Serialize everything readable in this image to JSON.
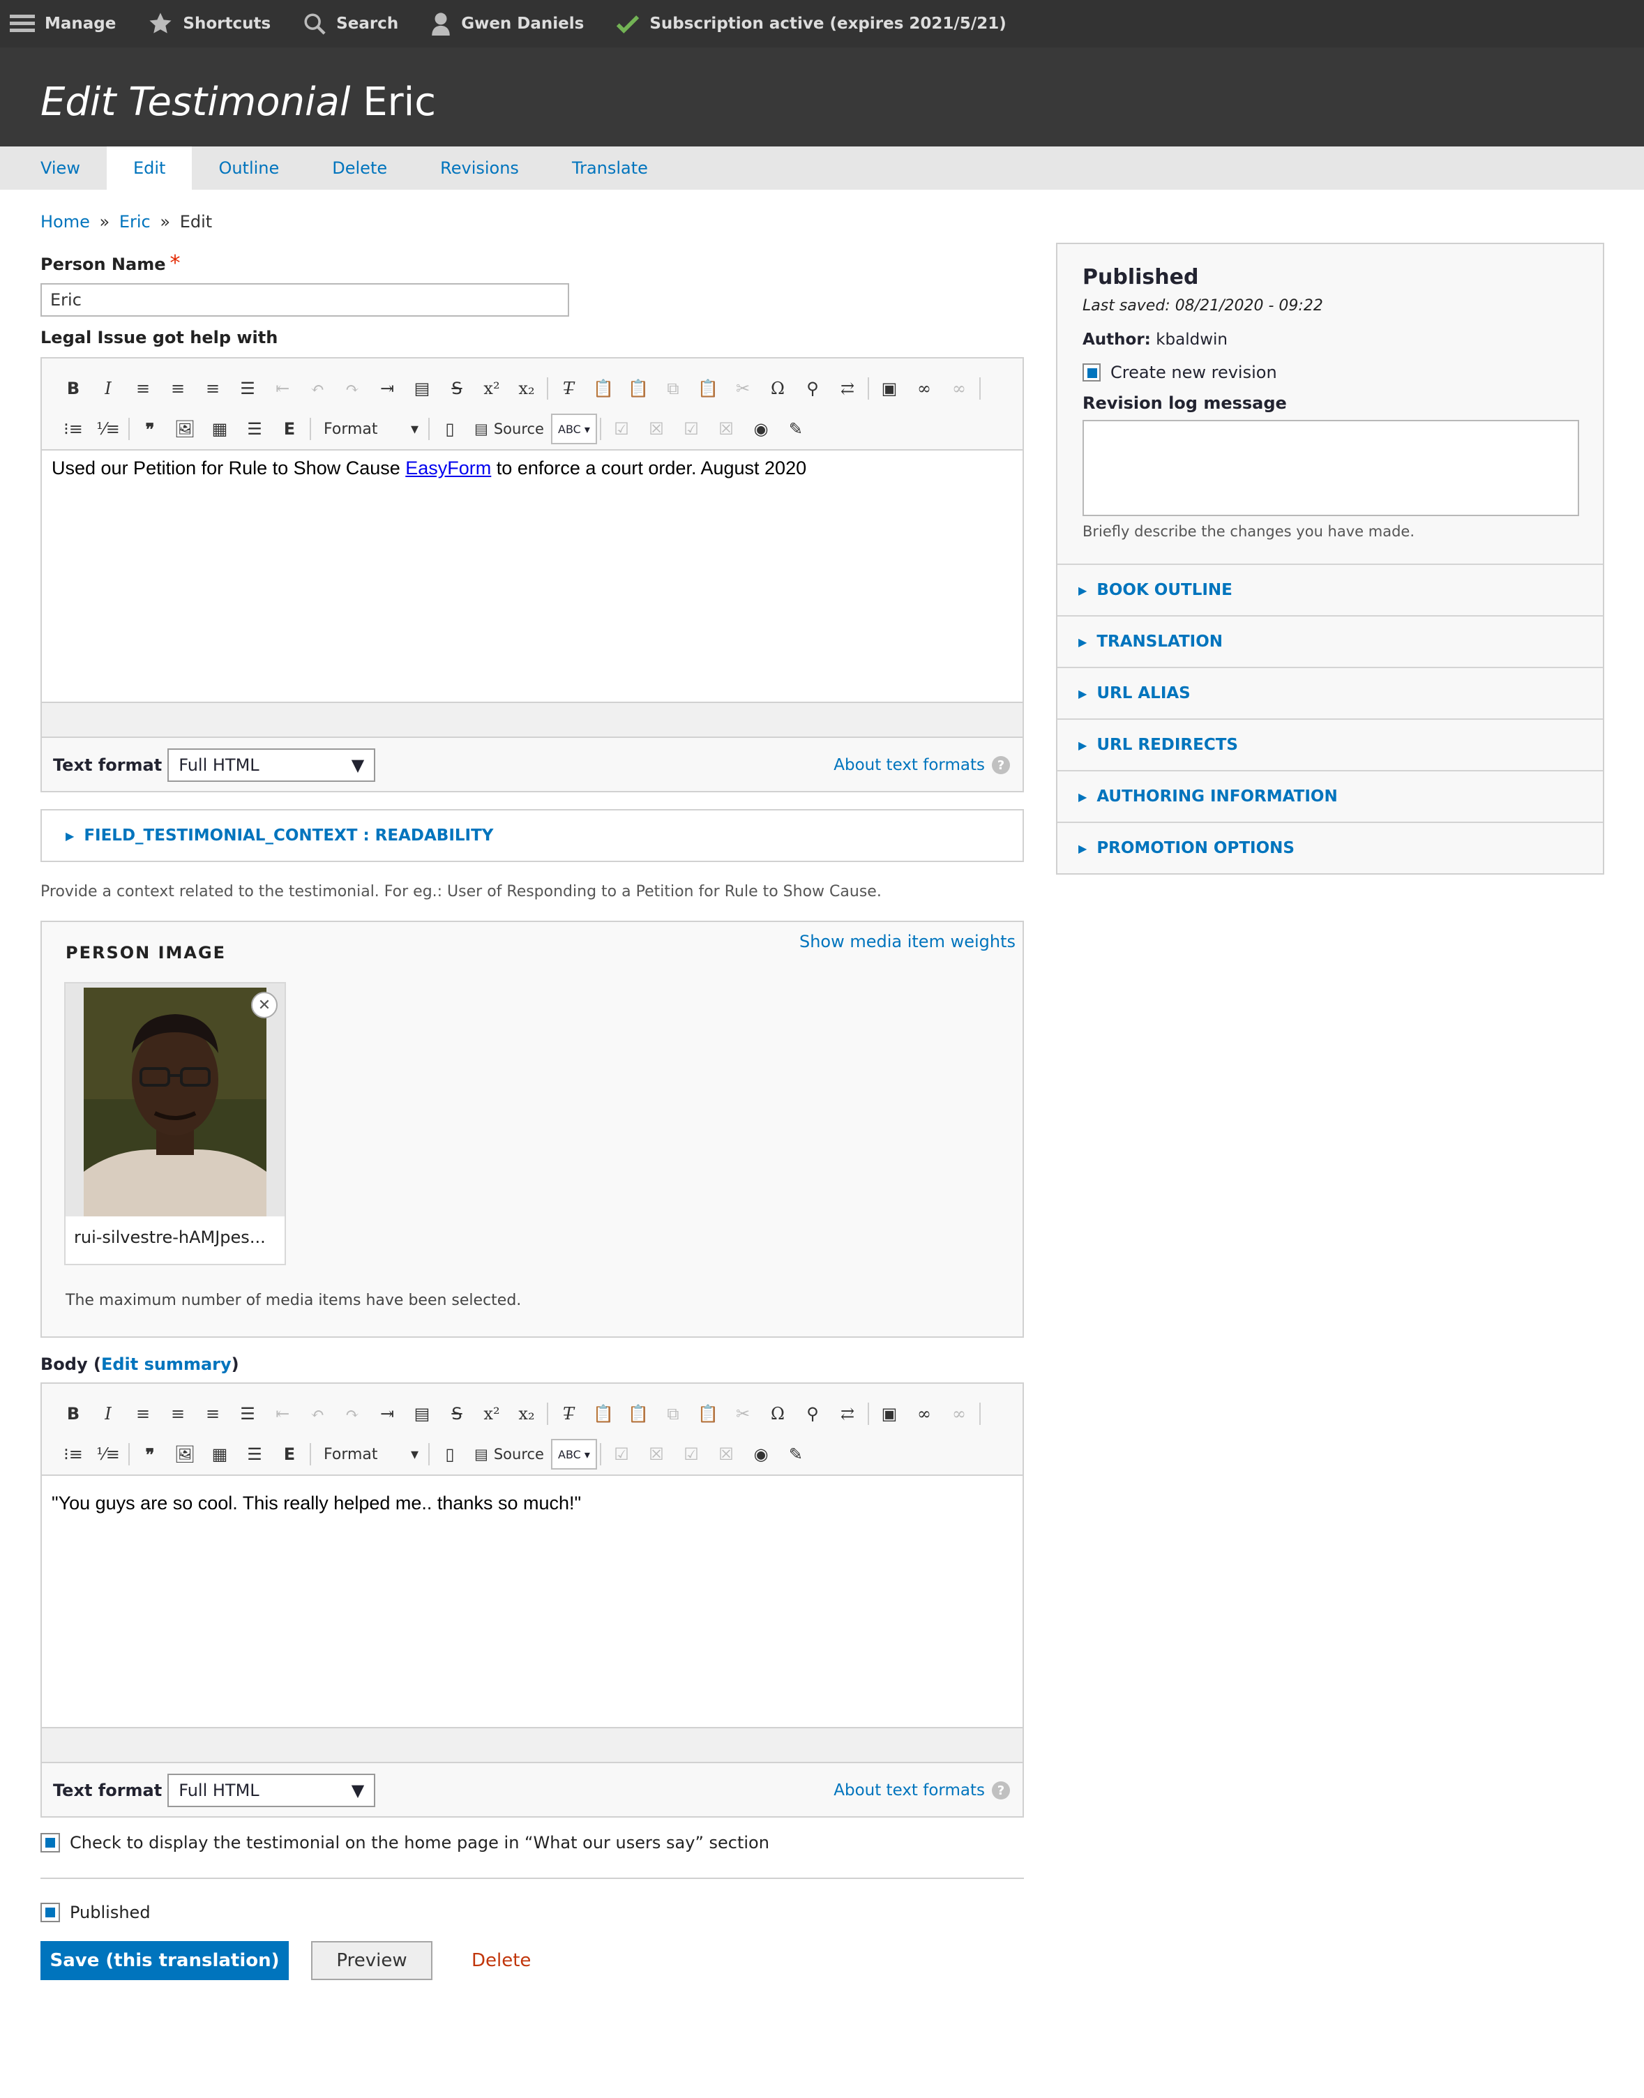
{
  "toolbar": {
    "manage": "Manage",
    "shortcuts": "Shortcuts",
    "search": "Search",
    "user": "Gwen Daniels",
    "subscription": "Subscription active (expires 2021/5/21)"
  },
  "header": {
    "title_em": "Edit Testimonial",
    "title_name": "Eric"
  },
  "tabs": [
    {
      "label": "View"
    },
    {
      "label": "Edit",
      "active": true
    },
    {
      "label": "Outline"
    },
    {
      "label": "Delete"
    },
    {
      "label": "Revisions"
    },
    {
      "label": "Translate"
    }
  ],
  "breadcrumb": {
    "home": "Home",
    "sep": "»",
    "eric": "Eric",
    "current": "Edit"
  },
  "person_name": {
    "label": "Person Name",
    "required_mark": "*",
    "value": "Eric"
  },
  "legal_issue": {
    "label": "Legal Issue got help with",
    "content_before": "Used our Petition for Rule to Show Cause ",
    "content_link": "EasyForm",
    "content_after": " to enforce a court order. August 2020",
    "format_label": "Text format",
    "format_value": "Full HTML",
    "about_formats": "About text formats"
  },
  "editor_toolbar": {
    "format_combo": "Format",
    "source": "Source",
    "spell": "ABC"
  },
  "context_field": {
    "summary": "FIELD_TESTIMONIAL_CONTEXT : READABILITY",
    "description": "Provide a context related to the testimonial. For eg.: User of Responding to a Petition for Rule to Show Cause."
  },
  "person_image": {
    "title": "PERSON IMAGE",
    "show_weights": "Show media item weights",
    "file_name": "rui-silvestre-hAMJpes...",
    "max_message": "The maximum number of media items have been selected."
  },
  "body": {
    "label": "Body",
    "open_paren": "(",
    "edit_summary": "Edit summary",
    "close_paren": ")",
    "content": "\"You guys are so cool. This really helped me.. thanks so much!\"",
    "format_label": "Text format",
    "format_value": "Full HTML",
    "about_formats": "About text formats"
  },
  "home_display_check": {
    "label": "Check to display the testimonial on the home page in “What our users say” section",
    "checked": true
  },
  "published_check": {
    "label": "Published",
    "checked": true
  },
  "actions": {
    "save": "Save (this translation)",
    "preview": "Preview",
    "delete": "Delete"
  },
  "sidebar": {
    "status": "Published",
    "last_saved": "Last saved: 08/21/2020 - 09:22",
    "author_label": "Author:",
    "author_value": "kbaldwin",
    "new_revision": "Create new revision",
    "log_label": "Revision log message",
    "log_help": "Briefly describe the changes you have made.",
    "sections": [
      "BOOK OUTLINE",
      "TRANSLATION",
      "URL ALIAS",
      "URL REDIRECTS",
      "AUTHORING INFORMATION",
      "PROMOTION OPTIONS"
    ]
  },
  "colors": {
    "accent": "#0074bd",
    "toolbar_bg": "#333333",
    "header_bg": "#393939",
    "delete": "#c1360b",
    "success": "#73b355"
  }
}
